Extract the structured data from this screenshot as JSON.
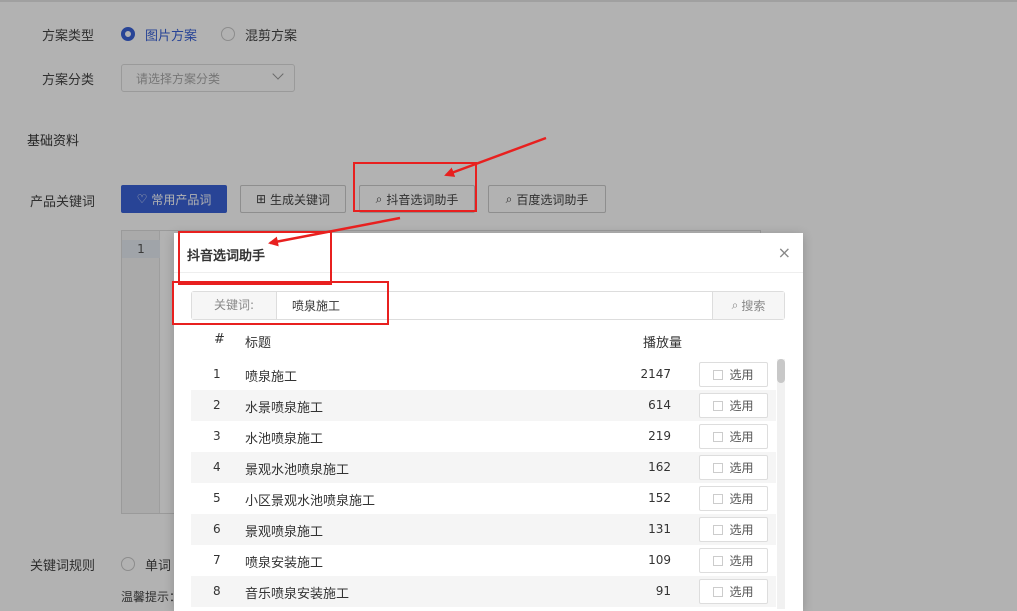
{
  "form": {
    "scheme_type_label": "方案类型",
    "scheme_type_options": [
      "图片方案",
      "混剪方案"
    ],
    "scheme_type_selected": "图片方案",
    "scheme_category_label": "方案分类",
    "scheme_category_placeholder": "请选择方案分类",
    "section_title": "基础资料",
    "keywords_label": "产品关键词",
    "keyword_buttons": {
      "common": "常用产品词",
      "generate": "生成关键词",
      "douyin": "抖音选词助手",
      "baidu": "百度选词助手"
    },
    "editor_line_number": "1",
    "keyword_rule_label": "关键词规则",
    "keyword_rule_option": "单词",
    "hint_text": "温馨提示："
  },
  "modal": {
    "title": "抖音选词助手",
    "close": "×",
    "search_prefix": "关键词:",
    "search_value": "喷泉施工",
    "search_button": "搜索",
    "columns": [
      "#",
      "标题",
      "播放量"
    ],
    "pick_label": "选用",
    "rows": [
      {
        "num": "1",
        "title": "喷泉施工",
        "plays": "2147"
      },
      {
        "num": "2",
        "title": "水景喷泉施工",
        "plays": "614"
      },
      {
        "num": "3",
        "title": "水池喷泉施工",
        "plays": "219"
      },
      {
        "num": "4",
        "title": "景观水池喷泉施工",
        "plays": "162"
      },
      {
        "num": "5",
        "title": "小区景观水池喷泉施工",
        "plays": "152"
      },
      {
        "num": "6",
        "title": "景观喷泉施工",
        "plays": "131"
      },
      {
        "num": "7",
        "title": "喷泉安装施工",
        "plays": "109"
      },
      {
        "num": "8",
        "title": "音乐喷泉安装施工",
        "plays": "91"
      }
    ]
  },
  "colors": {
    "primary": "#3a62d7",
    "annotation_red": "#e8201f",
    "overlay": "rgba(0,0,0,0.3)"
  },
  "icons": {
    "heart": "heart-icon",
    "plus_square": "plus-square-icon",
    "search": "search-icon",
    "close": "close-icon"
  }
}
